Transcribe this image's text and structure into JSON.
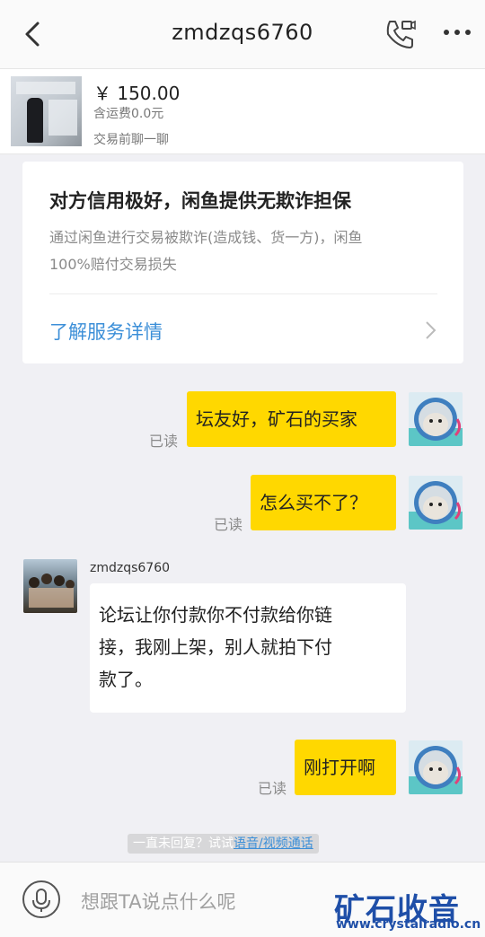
{
  "header": {
    "title": "zmdzqs6760",
    "back_icon": "chevron-left-icon",
    "call_icon": "phone-video-icon",
    "more_icon": "more-dots-icon"
  },
  "product": {
    "price": "￥ 150.00",
    "shipping": "含运费0.0元",
    "note": "交易前聊一聊"
  },
  "guarantee_card": {
    "title": "对方信用极好，闲鱼提供无欺诈担保",
    "desc_line1": "通过闲鱼进行交易被欺诈(造成钱、货一方)，闲鱼",
    "desc_line2": "100%赔付交易损失",
    "link": "了解服务详情"
  },
  "messages": [
    {
      "from": "me",
      "text": "坛友好，矿石的买家",
      "status": "已读"
    },
    {
      "from": "me",
      "text": "怎么买不了？",
      "status": "已读"
    },
    {
      "from": "other",
      "sender": "zmdzqs6760",
      "line1": "论坛让你付款你不付款给你链",
      "line2": "接，我刚上架，别人就拍下付",
      "line3": "款了。"
    },
    {
      "from": "me",
      "text": "刚打开啊",
      "status": "已读"
    }
  ],
  "hint": {
    "prefix": "一直未回复？试试",
    "link": "语音/视频通话"
  },
  "input": {
    "placeholder": "想跟TA说点什么呢"
  },
  "watermark": {
    "main": "矿石收音机",
    "url": "www.crystalradio.cn"
  },
  "colors": {
    "my_bubble": "#ffd800",
    "link": "#3c8fd8",
    "watermark": "#1f4fa8"
  }
}
